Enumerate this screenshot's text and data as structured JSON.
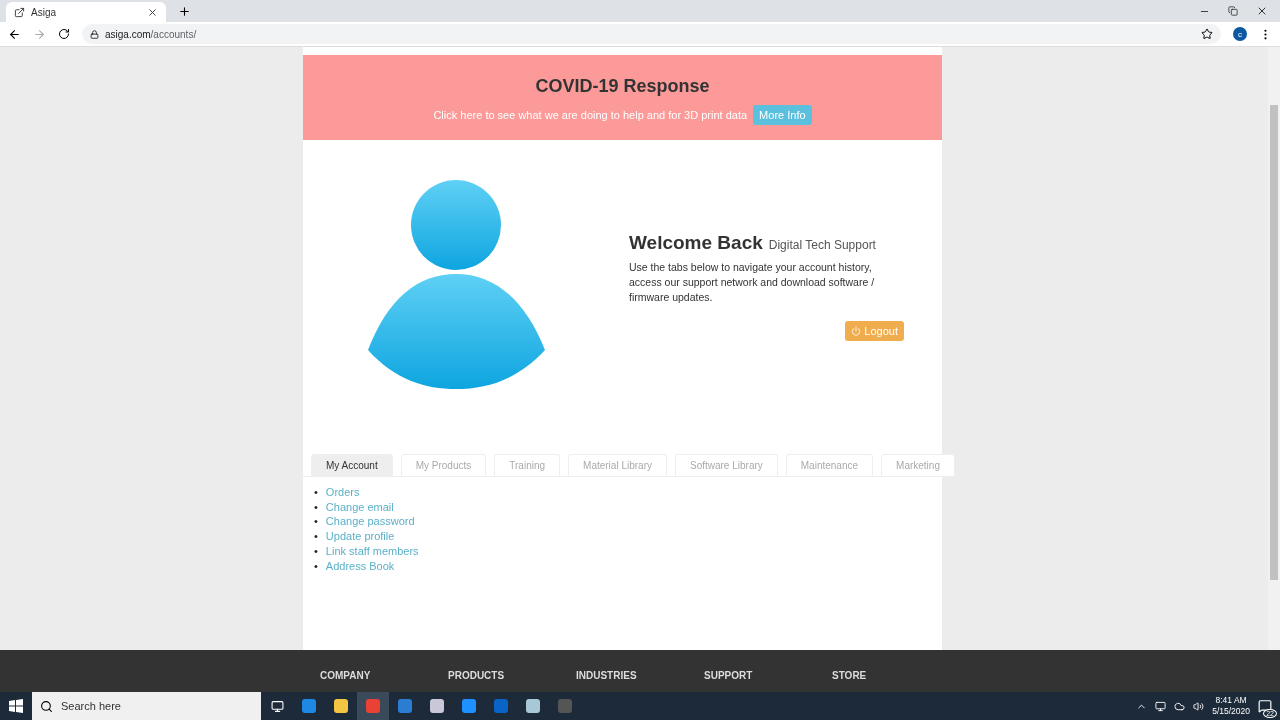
{
  "browser": {
    "tab_title": "Asiga",
    "url_host": "asiga.com",
    "url_path": "/accounts/",
    "profile": "c"
  },
  "banner": {
    "title": "COVID-19 Response",
    "text": "Click here to see what we are doing to help and for 3D print data",
    "button": "More Info"
  },
  "welcome": {
    "title": "Welcome Back",
    "user": "Digital Tech Support",
    "text": "Use the tabs below to navigate your account history, access our support network and download software / firmware updates.",
    "logout": "Logout"
  },
  "tabs": [
    {
      "label": "My Account",
      "selected": true
    },
    {
      "label": "My Products",
      "selected": false
    },
    {
      "label": "Training",
      "selected": false
    },
    {
      "label": "Material Library",
      "selected": false
    },
    {
      "label": "Software Library",
      "selected": false
    },
    {
      "label": "Maintenance",
      "selected": false
    },
    {
      "label": "Marketing",
      "selected": false
    }
  ],
  "links": [
    {
      "bullet": "•",
      "label": "Orders"
    },
    {
      "bullet": "•",
      "label": "Change email"
    },
    {
      "bullet": "•",
      "label": "Change password"
    },
    {
      "bullet": "•",
      "label": "Update profile"
    },
    {
      "bullet": "•",
      "label": "Link staff members"
    },
    {
      "bullet": "•",
      "label": "Address Book"
    }
  ],
  "footer": [
    {
      "heading": "COMPANY"
    },
    {
      "heading": "PRODUCTS"
    },
    {
      "heading": "INDUSTRIES"
    },
    {
      "heading": "SUPPORT"
    },
    {
      "heading": "STORE"
    }
  ],
  "taskbar": {
    "search_placeholder": "Search here",
    "time": "8:41 AM",
    "date": "5/15/2020",
    "notifications": "22"
  }
}
